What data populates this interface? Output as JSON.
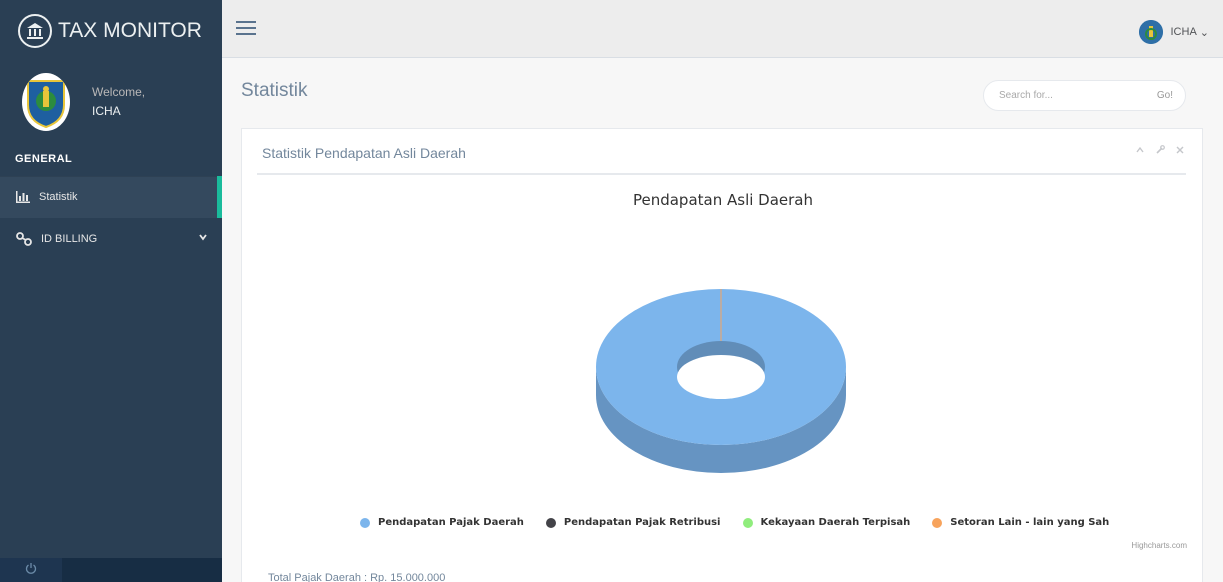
{
  "app": {
    "title": "TAX MONITOR"
  },
  "profile": {
    "welcome": "Welcome,",
    "name": "ICHA"
  },
  "sidebar": {
    "section": "GENERAL",
    "items": [
      {
        "label": "Statistik",
        "icon": "bar-chart-icon",
        "active": true
      },
      {
        "label": "ID BILLING",
        "icon": "link-icon",
        "active": false
      }
    ]
  },
  "topnav": {
    "user": "ICHA",
    "caret": "⌄"
  },
  "page": {
    "title": "Statistik"
  },
  "search": {
    "placeholder": "Search for...",
    "go_label": "Go!"
  },
  "panel": {
    "title": "Statistik Pendapatan Asli Daerah",
    "tools": [
      "chevron-up-icon",
      "wrench-icon",
      "close-icon"
    ]
  },
  "chart_data": {
    "type": "pie",
    "variant": "3d-donut",
    "title": "Pendapatan Asli Daerah",
    "series": [
      {
        "name": "Pendapatan Pajak Daerah",
        "color": "#7CB5EC",
        "value": 100
      },
      {
        "name": "Pendapatan Pajak Retribusi",
        "color": "#434348",
        "value": 0
      },
      {
        "name": "Kekayaan Daerah Terpisah",
        "color": "#90ED7D",
        "value": 0
      },
      {
        "name": "Setoran Lain - lain yang Sah",
        "color": "#F7A35C",
        "value": 0
      }
    ],
    "legend_position": "bottom",
    "credits": "Highcharts.com"
  },
  "summary": {
    "total_line": "Total Pajak Daerah : Rp. 15.000.000"
  },
  "colors": {
    "sidebar": "#2A3F54",
    "accent": "#1ABB9C"
  }
}
